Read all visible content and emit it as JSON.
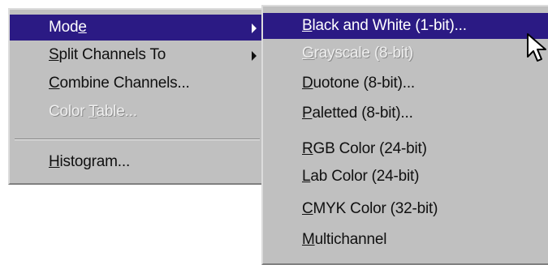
{
  "main_menu": {
    "items": [
      {
        "before": "Mod",
        "key": "e",
        "after": "",
        "state": "selected",
        "has_submenu": true
      },
      {
        "before": "",
        "key": "S",
        "after": "plit Channels To",
        "state": "normal",
        "has_submenu": true
      },
      {
        "before": "",
        "key": "C",
        "after": "ombine Channels...",
        "state": "normal",
        "has_submenu": false
      },
      {
        "before": "Color ",
        "key": "T",
        "after": "able...",
        "state": "disabled",
        "has_submenu": false
      },
      {
        "before": "",
        "key": "H",
        "after": "istogram...",
        "state": "normal",
        "has_submenu": false
      }
    ]
  },
  "mode_submenu": {
    "items": [
      {
        "before": "",
        "key": "B",
        "after": "lack and White (1-bit)...",
        "state": "selected"
      },
      {
        "before": "",
        "key": "G",
        "after": "rayscale (8-bit)",
        "state": "disabled"
      },
      {
        "before": "",
        "key": "D",
        "after": "uotone (8-bit)...",
        "state": "normal"
      },
      {
        "before": "",
        "key": "P",
        "after": "aletted (8-bit)...",
        "state": "normal"
      },
      {
        "before": "",
        "key": "R",
        "after": "GB Color (24-bit)",
        "state": "normal"
      },
      {
        "before": "",
        "key": "L",
        "after": "ab Color (24-bit)",
        "state": "normal"
      },
      {
        "before": "",
        "key": "C",
        "after": "MYK Color (32-bit)",
        "state": "normal"
      },
      {
        "before": "",
        "key": "M",
        "after": "ultichannel",
        "state": "normal"
      }
    ]
  },
  "colors": {
    "menu_background": "#c0c0c0",
    "selection_highlight": "#2b1a84",
    "selection_text": "#ffffff",
    "disabled_text": "#eeeeee"
  },
  "icons": {
    "submenu_arrow": "chevron-right-icon",
    "pointer": "mouse-cursor-icon"
  }
}
